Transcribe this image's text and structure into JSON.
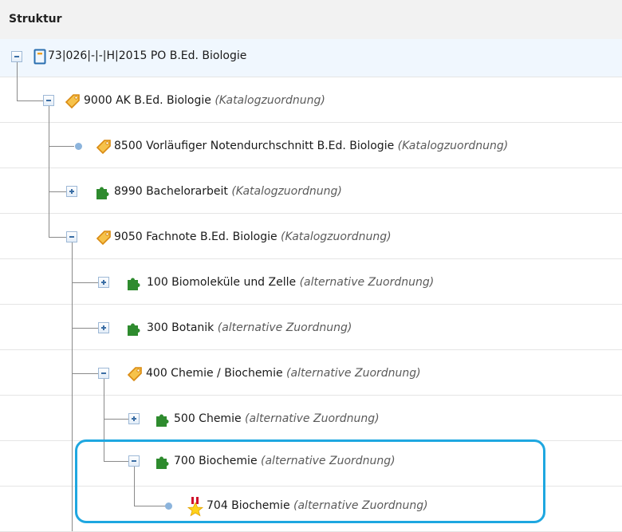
{
  "header": {
    "title": "Struktur"
  },
  "tree": {
    "root": {
      "label": "73|026|-|-|H|2015 PO B.Ed. Biologie",
      "icon": "program-bracket-icon"
    },
    "items": [
      {
        "label": "9000 AK B.Ed. Biologie",
        "kind": "(Katalogzuordnung)",
        "icon": "tag-icon",
        "toggle": "minus"
      },
      {
        "label": "8500 Vorläufiger Notendurchschnitt B.Ed. Biologie",
        "kind": "(Katalogzuordnung)",
        "icon": "tag-icon",
        "toggle": "leaf"
      },
      {
        "label": "8990 Bachelorarbeit",
        "kind": "(Katalogzuordnung)",
        "icon": "puzzle-piece-icon",
        "toggle": "plus"
      },
      {
        "label": "9050 Fachnote B.Ed. Biologie",
        "kind": "(Katalogzuordnung)",
        "icon": "tag-icon",
        "toggle": "minus"
      },
      {
        "label": "100 Biomoleküle und Zelle",
        "kind": "(alternative Zuordnung)",
        "icon": "puzzle-piece-icon",
        "toggle": "plus"
      },
      {
        "label": "300 Botanik",
        "kind": "(alternative Zuordnung)",
        "icon": "puzzle-piece-icon",
        "toggle": "plus"
      },
      {
        "label": "400 Chemie / Biochemie",
        "kind": "(alternative Zuordnung)",
        "icon": "tag-icon",
        "toggle": "minus"
      },
      {
        "label": "500 Chemie",
        "kind": "(alternative Zuordnung)",
        "icon": "puzzle-piece-icon",
        "toggle": "plus"
      },
      {
        "label": "700 Biochemie",
        "kind": "(alternative Zuordnung)",
        "icon": "puzzle-piece-icon",
        "toggle": "minus"
      },
      {
        "label": "704 Biochemie",
        "kind": "(alternative Zuordnung)",
        "icon": "star-badge-icon",
        "toggle": "leaf"
      }
    ]
  },
  "colors": {
    "highlight": "#1ea7e0",
    "puzzle": "#2e8b2e",
    "tag": "#f0a020",
    "dot": "#8cb4dc"
  }
}
